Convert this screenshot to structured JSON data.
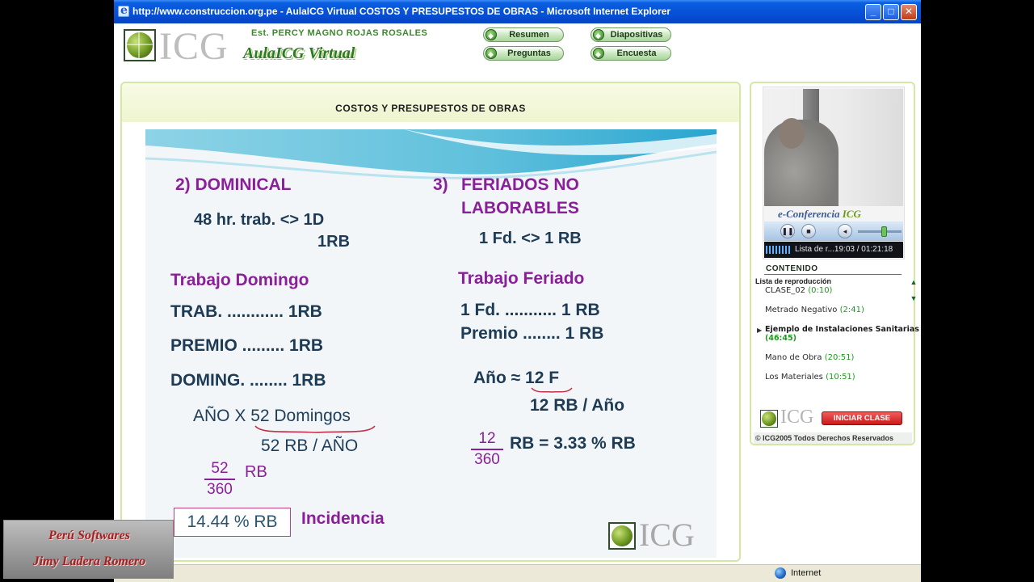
{
  "window": {
    "title": "http://www.construccion.org.pe - AulaICG Virtual COSTOS Y PRESUPESTOS DE OBRAS - Microsoft Internet Explorer",
    "minimize": "_",
    "maximize": "□",
    "close": "✕"
  },
  "header": {
    "logo_text": "ICG",
    "author": "Est. PERCY MAGNO ROJAS ROSALES",
    "aula": "AulaICG Virtual",
    "nav": [
      "Resumen",
      "Diapositivas",
      "Preguntas",
      "Encuesta"
    ]
  },
  "main": {
    "title": "COSTOS Y PRESUPESTOS DE OBRAS"
  },
  "slide": {
    "left": {
      "heading": "2) DOMINICAL",
      "eq1a": "48 hr. trab. <> 1D",
      "eq1b": "1RB",
      "sub": "Trabajo Domingo",
      "line1": "TRAB. ............ 1RB",
      "line2": "PREMIO ......... 1RB",
      "line3": "DOMING. ........ 1RB",
      "ano_prefix": "AÑO X ",
      "ano_domingos": "52 Domingos",
      "rb_ano": "52 RB / AÑO",
      "frac_num": "52",
      "frac_den": "360",
      "frac_unit": "RB",
      "result": "14.44 % RB",
      "incidencia": "Incidencia"
    },
    "right": {
      "heading_num": "3)",
      "heading_line1": "FERIADOS NO",
      "heading_line2": "LABORABLES",
      "eq1": "1 Fd. <> 1 RB",
      "sub": "Trabajo Feriado",
      "line1": "1 Fd. ........... 1 RB",
      "line2": "Premio ........ 1 RB",
      "ano_prefix": "Año ≈ ",
      "ano_value": "12 F",
      "rb_ano": "12 RB / Año",
      "frac_num": "12",
      "frac_den": "360",
      "frac_result": "RB = 3.33 % RB"
    },
    "logo_text": "ICG"
  },
  "sidebar": {
    "econf_prefix": "e-Conferencia ",
    "econf_brand": "ICG",
    "player_status": "Lista de r...19:03 / 01:21:18",
    "contenido": "CONTENIDO",
    "playlist_label": "Lista de reproducción",
    "items": [
      {
        "name": "CLASE_02 ",
        "dur": "(0:10)"
      },
      {
        "name": "Metrado Negativo ",
        "dur": "(2:41)"
      },
      {
        "name": "Ejemplo de Instalaciones Sanitarias",
        "dur": "(46:45)"
      },
      {
        "name": "Mano de Obra ",
        "dur": "(20:51)"
      },
      {
        "name": "Los Materiales ",
        "dur": "(10:51)"
      }
    ],
    "logo_text": "ICG",
    "iniciar": "INICIAR CLASE",
    "copyright": "© ICG2005 Todos Derechos Reservados"
  },
  "statusbar": {
    "zone": "Internet"
  },
  "watermark": {
    "line1": "Perú Softwares",
    "line2": "Jimy Ladera Romero"
  }
}
